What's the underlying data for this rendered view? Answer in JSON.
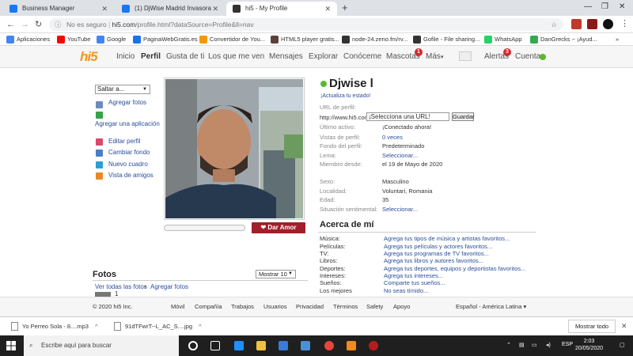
{
  "browser": {
    "tabs": [
      {
        "label": "Business Manager",
        "color": "#1877f2"
      },
      {
        "label": "(1) DjWise Madrid Invasora",
        "color": "#1877f2"
      },
      {
        "label": "hi5 - My Profile",
        "color": "#333333",
        "active": true
      }
    ],
    "new_tab": "+",
    "url_security": "No es seguro",
    "url_host": "hi5.com",
    "url_path": "/profile.html?dataSource=Profile&ll=nav",
    "bookmarks": [
      {
        "label": "Aplicaciones",
        "color": "#4285f4"
      },
      {
        "label": "YouTube",
        "color": "#ff0000"
      },
      {
        "label": "Google",
        "color": "#4285f4"
      },
      {
        "label": "PaginaWebGratis.es",
        "color": "#1a73e8"
      },
      {
        "label": "Convertidor de You...",
        "color": "#f29900"
      },
      {
        "label": "HTML5 player gratis...",
        "color": "#5d4037"
      },
      {
        "label": "node-24.zeno.fm/rv...",
        "color": "#333333"
      },
      {
        "label": "Gofile - File sharing...",
        "color": "#333333"
      },
      {
        "label": "WhatsApp",
        "color": "#25d366"
      },
      {
        "label": "DanGrecks ~ ¡Ayud...",
        "color": "#34a853"
      }
    ],
    "bookmarks_more": "»"
  },
  "hi5": {
    "logo": "hi5",
    "nav": [
      "Inicio",
      "Perfil",
      "Gusta de ti",
      "Los que me ven",
      "Mensajes",
      "Explorar",
      "Conóceme",
      "Mascotas",
      "Más",
      "Alertas",
      "Cuenta"
    ],
    "mascotas_badge": "1",
    "alertas_badge": "3",
    "nav_more_arrow": "▾",
    "left": {
      "select_label": "Saltar a...",
      "links": [
        "Agregar fotos",
        "Agregar una aplicación",
        "Editar perfil",
        "Cambiar fondo",
        "Nuevo cuadro",
        "Vista de amigos"
      ]
    },
    "love_button": "Dar Amor",
    "profile": {
      "username": "Djwise l",
      "update_status": "¡Actualiza tu estado!",
      "url_label": "URL de perfil:",
      "url_prefix": "http://www.hi5.com/",
      "url_input": "¡Selecciona una URL!",
      "save_button": "Guardar",
      "fields": [
        {
          "label": "Último activo:",
          "value": "¡Conectado ahora!",
          "link": false
        },
        {
          "label": "Vistas de perfil:",
          "value": "0 veces",
          "link": true
        },
        {
          "label": "Fondo del perfil:",
          "value": "Predeterminado",
          "link": false
        },
        {
          "label": "Lema:",
          "value": "Seleccionar...",
          "link": true
        },
        {
          "label": "Miembro desde:",
          "value": "el 19 de Mayo de 2020",
          "link": false
        }
      ],
      "fields2": [
        {
          "label": "Sexo:",
          "value": "Masculino",
          "link": false
        },
        {
          "label": "Localidad:",
          "value": "Voluntari, Romania",
          "link": false
        },
        {
          "label": "Edad:",
          "value": "35",
          "link": false
        },
        {
          "label": "Situación sentimental:",
          "value": "Seleccionar...",
          "link": true
        }
      ]
    },
    "about": {
      "title": "Acerca de mí",
      "items": [
        {
          "label": "Música:",
          "value": "Agrega tus tipos de música y artistas favoritos..."
        },
        {
          "label": "Películas:",
          "value": "Agrega tus películas y actores favoritos..."
        },
        {
          "label": "TV:",
          "value": "Agrega tus programas de TV favoritos..."
        },
        {
          "label": "Libros:",
          "value": "Agrega tus libros y autores favoritos..."
        },
        {
          "label": "Deportes:",
          "value": "Agrega tus deportes, equipos y deportistas favoritos..."
        },
        {
          "label": "Intereses:",
          "value": "Agrega tus intereses..."
        },
        {
          "label": "Sueños:",
          "value": "Comparte tus sueños..."
        },
        {
          "label": "Los mejores",
          "value": "No seas tímido..."
        }
      ]
    },
    "fotos": {
      "title": "Fotos",
      "mostrar": "Mostrar 10",
      "ver_todas": "Ver todas las fotos",
      "separator": "•",
      "agregar": "Agregar fotos",
      "count": "1"
    },
    "footer": {
      "copyright": "© 2020 hi5 Inc.",
      "links": [
        "Móvil",
        "Compañía",
        "Trabajos",
        "Usuarios",
        "Privacidad",
        "Términos",
        "Safety",
        "Apoyo"
      ],
      "language": "Español - América Latina",
      "language_arrow": "▾"
    }
  },
  "downloads": {
    "items": [
      {
        "label": "Yo Perreo Sola - 8....mp3"
      },
      {
        "label": "91dTFwrT--L_AC_S....jpg"
      }
    ],
    "show_all": "Mostrar todo",
    "close": "✕"
  },
  "taskbar": {
    "search_placeholder": "Escribe aquí para buscar",
    "language": "ESP",
    "time": "2:03",
    "date": "20/05/2020"
  }
}
